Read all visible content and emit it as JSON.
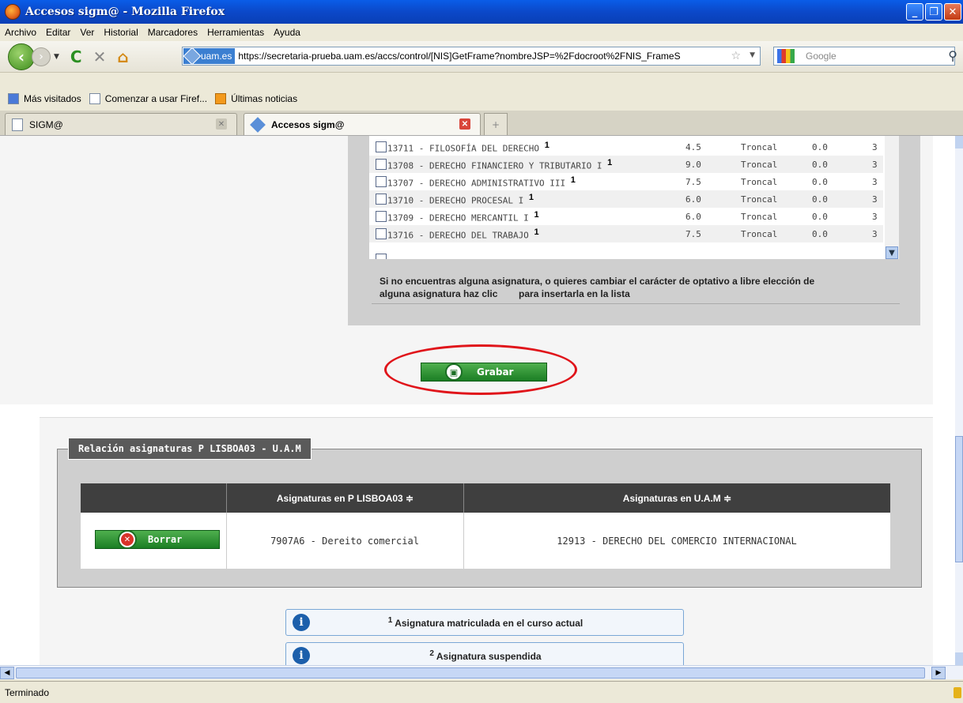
{
  "window": {
    "title": "Accesos sigm@ - Mozilla Firefox"
  },
  "menu": [
    "Archivo",
    "Editar",
    "Ver",
    "Historial",
    "Marcadores",
    "Herramientas",
    "Ayuda"
  ],
  "nav": {
    "site_badge": "uam.es",
    "url": "https://secretaria-prueba.uam.es/accs/control/[NIS]GetFrame?nombreJSP=%2Fdocroot%2FNIS_FrameS",
    "search_placeholder": "Google"
  },
  "bookmarks": [
    "Más visitados",
    "Comenzar a usar Firef...",
    "Últimas noticias"
  ],
  "tabs": [
    {
      "label": "SIGM@"
    },
    {
      "label": "Accesos sigm@"
    }
  ],
  "subjects": [
    {
      "code_name": "13711 - FILOSOFÍA DEL DERECHO",
      "sup": "1",
      "credits": "4.5",
      "type": "Troncal",
      "value": "0.0",
      "num": "3"
    },
    {
      "code_name": "13708 - DERECHO FINANCIERO Y TRIBUTARIO I",
      "sup": "1",
      "credits": "9.0",
      "type": "Troncal",
      "value": "0.0",
      "num": "3"
    },
    {
      "code_name": "13707 - DERECHO ADMINISTRATIVO III",
      "sup": "1",
      "credits": "7.5",
      "type": "Troncal",
      "value": "0.0",
      "num": "3"
    },
    {
      "code_name": "13710 - DERECHO PROCESAL I",
      "sup": "1",
      "credits": "6.0",
      "type": "Troncal",
      "value": "0.0",
      "num": "3"
    },
    {
      "code_name": "13709 - DERECHO MERCANTIL I",
      "sup": "1",
      "credits": "6.0",
      "type": "Troncal",
      "value": "0.0",
      "num": "3"
    },
    {
      "code_name": "13716 - DERECHO DEL TRABAJO",
      "sup": "1",
      "credits": "7.5",
      "type": "Troncal",
      "value": "0.0",
      "num": "3"
    }
  ],
  "notice": {
    "line1": "Si no encuentras alguna asignatura, o quieres cambiar el carácter de optativo a libre elección de",
    "line2": "alguna asignatura haz clic        para insertarla en la lista"
  },
  "save_button": {
    "label": "Grabar"
  },
  "relation": {
    "legend": "Relación asignaturas P LISBOA03 - U.A.M",
    "col1": "Asignaturas en P LISBOA03 ≑",
    "col2": "Asignaturas en U.A.M ≑",
    "rows": [
      {
        "delete_label": "Borrar",
        "origin": "7907A6 - Dereito comercial",
        "target": "12913 - DERECHO DEL COMERCIO INTERNACIONAL"
      }
    ]
  },
  "legend_notes": [
    {
      "sup": "1",
      "text": "Asignatura matriculada en el curso actual"
    },
    {
      "sup": "2",
      "text": "Asignatura suspendida"
    }
  ],
  "status": {
    "text": "Terminado"
  }
}
